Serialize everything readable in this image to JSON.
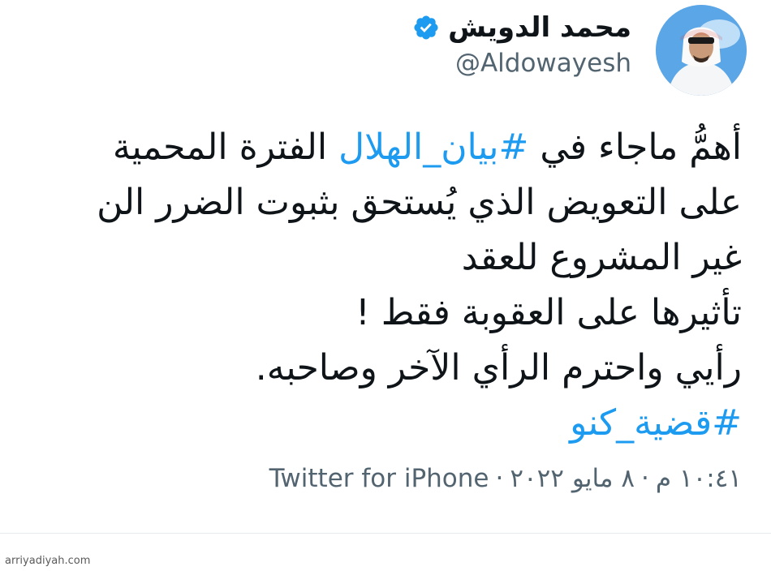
{
  "author": {
    "display_name": "محمد الدويش",
    "handle": "@Aldowayesh",
    "verified": true,
    "avatar_icon": "profile-photo"
  },
  "tweet": {
    "lines": [
      {
        "before": "أهمُّ ماجاء في ",
        "hashtag": "#بيان_الهلال",
        "after": " الفترة المحمية"
      },
      {
        "text": "على التعويض الذي يُستحق بثبوت الضرر الن"
      },
      {
        "text": "غير المشروع للعقد"
      },
      {
        "text": "تأثيرها على العقوبة فقط !"
      },
      {
        "text": "رأيي واحترم الرأي الآخر وصاحبه."
      },
      {
        "hashtag": "#قضية_كنو"
      }
    ]
  },
  "meta": {
    "time": "١٠:٤١ م",
    "date": "٨ مايو ٢٠٢٢",
    "source": "Twitter for iPhone",
    "separator": "·"
  },
  "watermark": "arriyadiyah.com",
  "colors": {
    "hashtag": "#1d9bf0",
    "verified_badge": "#1d9bf0",
    "secondary_text": "#536471"
  }
}
